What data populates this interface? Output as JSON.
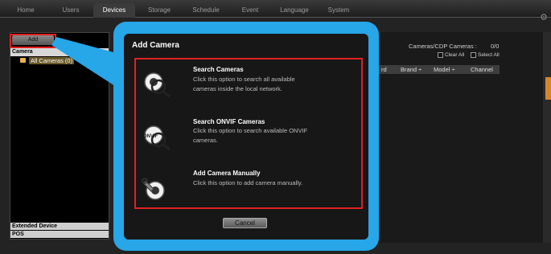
{
  "nav": {
    "tabs": [
      {
        "label": "Home"
      },
      {
        "label": "Users"
      },
      {
        "label": "Devices"
      },
      {
        "label": "Storage"
      },
      {
        "label": "Schedule"
      },
      {
        "label": "Event"
      },
      {
        "label": "Language"
      },
      {
        "label": "System"
      }
    ],
    "active_tab": "Devices"
  },
  "left_panel": {
    "add_label": "Add",
    "camera_header": "Camera",
    "all_cameras": "All Cameras (0)",
    "extended_device": "Extended Device",
    "pos": "POS"
  },
  "right_panel": {
    "cdp_label": "Cameras/CDP Cameras :",
    "cdp_value": "0/0",
    "clear_all": "Clear All",
    "select_all": "Select All",
    "columns": [
      "rd",
      "Brand ÷",
      "Model ÷",
      "Channel"
    ]
  },
  "dialog": {
    "title": "Add Camera",
    "options": [
      {
        "title": "Search Cameras",
        "description": "Click this option to search all available cameras inside the local network."
      },
      {
        "title": "Search ONVIF Cameras",
        "description": "Click this option to search available ONVIF cameras."
      },
      {
        "title": "Add Camera Manually",
        "description": "Click this option to add camera manually."
      }
    ],
    "onvif_badge": "ONVIF",
    "cancel_label": "Cancel"
  },
  "colors": {
    "callout": "#27a6e8",
    "highlight": "#e0201f",
    "accent": "#d4862b"
  },
  "icons": [
    "camera-search-icon",
    "onvif-search-icon",
    "manual-add-camera-icon",
    "folder-icon",
    "settings-icon"
  ]
}
